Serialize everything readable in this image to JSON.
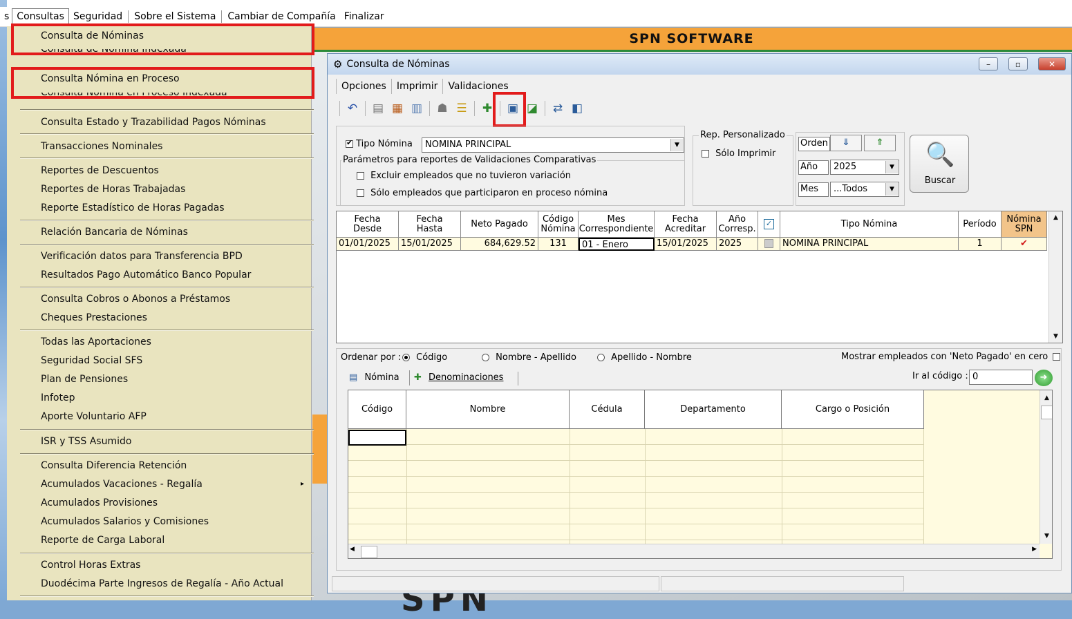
{
  "app": {
    "brand": "SPN SOFTWARE",
    "background_logo": "SPN"
  },
  "menubar": {
    "items": [
      "s",
      "Consultas",
      "Seguridad",
      "Sobre el Sistema",
      "Cambiar de Compañía",
      "Finalizar"
    ]
  },
  "dropdown": {
    "items": [
      "Consulta de Nóminas",
      "Consulta de Nómina Indexada",
      "Consulta Nómina en Proceso",
      "Consulta Nómina en Proceso Indexada",
      "Consulta Estado y Trazabilidad Pagos Nóminas",
      "Transacciones Nominales",
      "Reportes de Descuentos",
      "Reportes de Horas Trabajadas",
      "Reporte Estadístico de Horas Pagadas",
      "Relación Bancaria de Nóminas",
      "Verificación datos para Transferencia BPD",
      "Resultados Pago Automático Banco Popular",
      "Consulta Cobros o Abonos a Préstamos",
      "Cheques Prestaciones",
      "Todas las Aportaciones",
      "Seguridad Social SFS",
      "Plan de Pensiones",
      "Infotep",
      "Aporte Voluntario AFP",
      "ISR y TSS Asumido",
      "Consulta Diferencia Retención",
      "Acumulados Vacaciones - Regalía",
      "Acumulados Provisiones",
      "Acumulados Salarios y Comisiones",
      "Reporte de Carga Laboral",
      "Control Horas Extras",
      "Duodécima Parte Ingresos de Regalía - Año Actual"
    ],
    "submenu_arrow": "▸"
  },
  "window": {
    "title": "Consulta de Nóminas",
    "menu": [
      "Opciones",
      "Imprimir",
      "Validaciones"
    ],
    "controls": {
      "minimize": "–",
      "maximize": "▫",
      "close": "✕"
    }
  },
  "filters": {
    "tipo_nomina_label": "Tipo Nómina",
    "tipo_nomina_checked": true,
    "tipo_nomina_value": "NOMINA PRINCIPAL",
    "params_group_title": "Parámetros para reportes de Validaciones Comparativas",
    "excluir_label": "Excluir empleados que no tuvieron variación",
    "solo_label": "Sólo empleados que participaron en proceso nómina",
    "rep_group_title": "Rep. Personalizado",
    "solo_imprimir_label": "Sólo Imprimir",
    "orden_label": "Orden",
    "anio_label": "Año",
    "anio_value": "2025",
    "mes_label": "Mes",
    "mes_value": "...Todos",
    "buscar_label": "Buscar"
  },
  "grid1": {
    "headers": [
      "Fecha\nDesde",
      "Fecha\nHasta",
      "Neto Pagado",
      "Código\nNómina",
      "Mes\nCorrespondiente",
      "Fecha\nAcreditar",
      "Año\nCorresp.",
      "✓",
      "Tipo Nómina",
      "Período",
      "Nómina\nSPN"
    ],
    "rows": [
      [
        "01/01/2025",
        "15/01/2025",
        "684,629.52",
        "131",
        "01 - Enero",
        "15/01/2025",
        "2025",
        "",
        "NOMINA PRINCIPAL",
        "1",
        "✔"
      ]
    ]
  },
  "bottom": {
    "ordenar_label": "Ordenar por :",
    "sort_options": [
      "Código",
      "Nombre - Apellido",
      "Apellido - Nombre"
    ],
    "sort_selected": "Código",
    "mostrar_label": "Mostrar empleados con 'Neto Pagado' en cero",
    "tabs": [
      "Nómina",
      "Denominaciones"
    ],
    "ir_label": "Ir al código :",
    "ir_value": "0",
    "grid_headers": [
      "Código",
      "Nombre",
      "Cédula",
      "Departamento",
      "Cargo o Posición"
    ]
  },
  "colors": {
    "menu_bg": "#e9e4bf",
    "highlight": "#e21b1b",
    "brand_bar": "#f5a33a",
    "grid_row": "#fffbe0"
  }
}
